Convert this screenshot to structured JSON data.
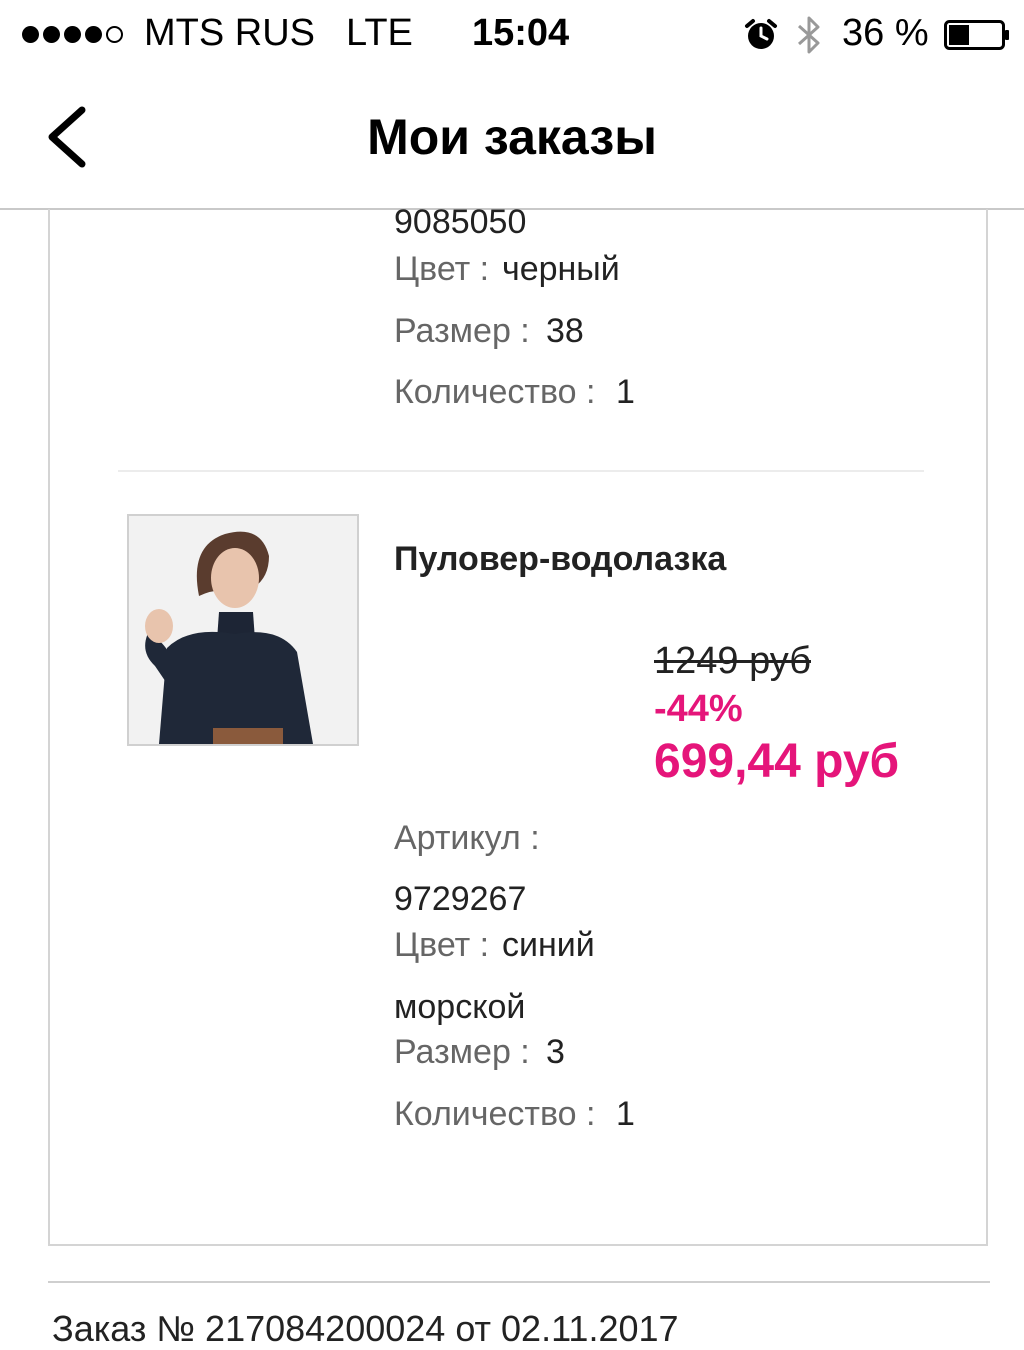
{
  "status_bar": {
    "carrier": "MTS RUS",
    "network": "LTE",
    "time": "15:04",
    "battery_percent": "36 %",
    "icons": [
      "signal-dots",
      "alarm-icon",
      "bluetooth-icon",
      "battery-icon"
    ]
  },
  "nav": {
    "title": "Мои заказы",
    "back_icon": "chevron-left-icon"
  },
  "items": [
    {
      "article_value": "9085050",
      "color_label": "Цвет :",
      "color_value": "черный",
      "size_label": "Размер :",
      "size_value": "38",
      "qty_label": "Количество :",
      "qty_value": "1"
    },
    {
      "name": "Пуловер-водолазка",
      "old_price": "1249 руб",
      "discount": "-44%",
      "price": "699,44 руб",
      "article_label": "Артикул :",
      "article_value": "9729267",
      "color_label": "Цвет :",
      "color_value_line1": "синий",
      "color_value_line2": "морской",
      "size_label": "Размер :",
      "size_value": "3",
      "qty_label": "Количество :",
      "qty_value": "1"
    }
  ],
  "next_order_partial": "Заказ № 217084200024 от 02.11.2017",
  "colors": {
    "accent": "#e5157a",
    "label_gray": "#666666",
    "border": "#d4d4d4"
  }
}
